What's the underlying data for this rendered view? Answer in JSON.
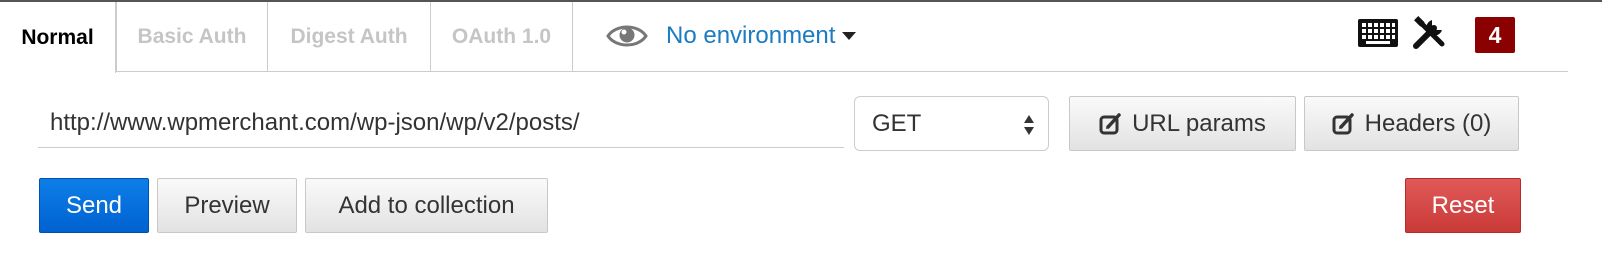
{
  "auth_tabs": [
    {
      "label": "Normal",
      "active": true
    },
    {
      "label": "Basic Auth",
      "active": false
    },
    {
      "label": "Digest Auth",
      "active": false
    },
    {
      "label": "OAuth 1.0",
      "active": false
    }
  ],
  "environment": {
    "label": "No environment",
    "icon": "eye-icon",
    "dropdown_icon": "caret-down-icon"
  },
  "toolbar": {
    "keyboard_icon": "keyboard-icon",
    "settings_icon": "tools-icon",
    "badge_count": "4"
  },
  "request": {
    "url": "http://www.wpmerchant.com/wp-json/wp/v2/posts/",
    "method": "GET",
    "url_params_label": "URL params",
    "headers_label": "Headers (0)"
  },
  "actions": {
    "send_label": "Send",
    "preview_label": "Preview",
    "add_to_collection_label": "Add to collection",
    "reset_label": "Reset"
  },
  "colors": {
    "link_blue": "#1a7cc2",
    "send_blue": "#0a6fdb",
    "reset_red": "#d44a48",
    "badge_red": "#8b0000"
  }
}
